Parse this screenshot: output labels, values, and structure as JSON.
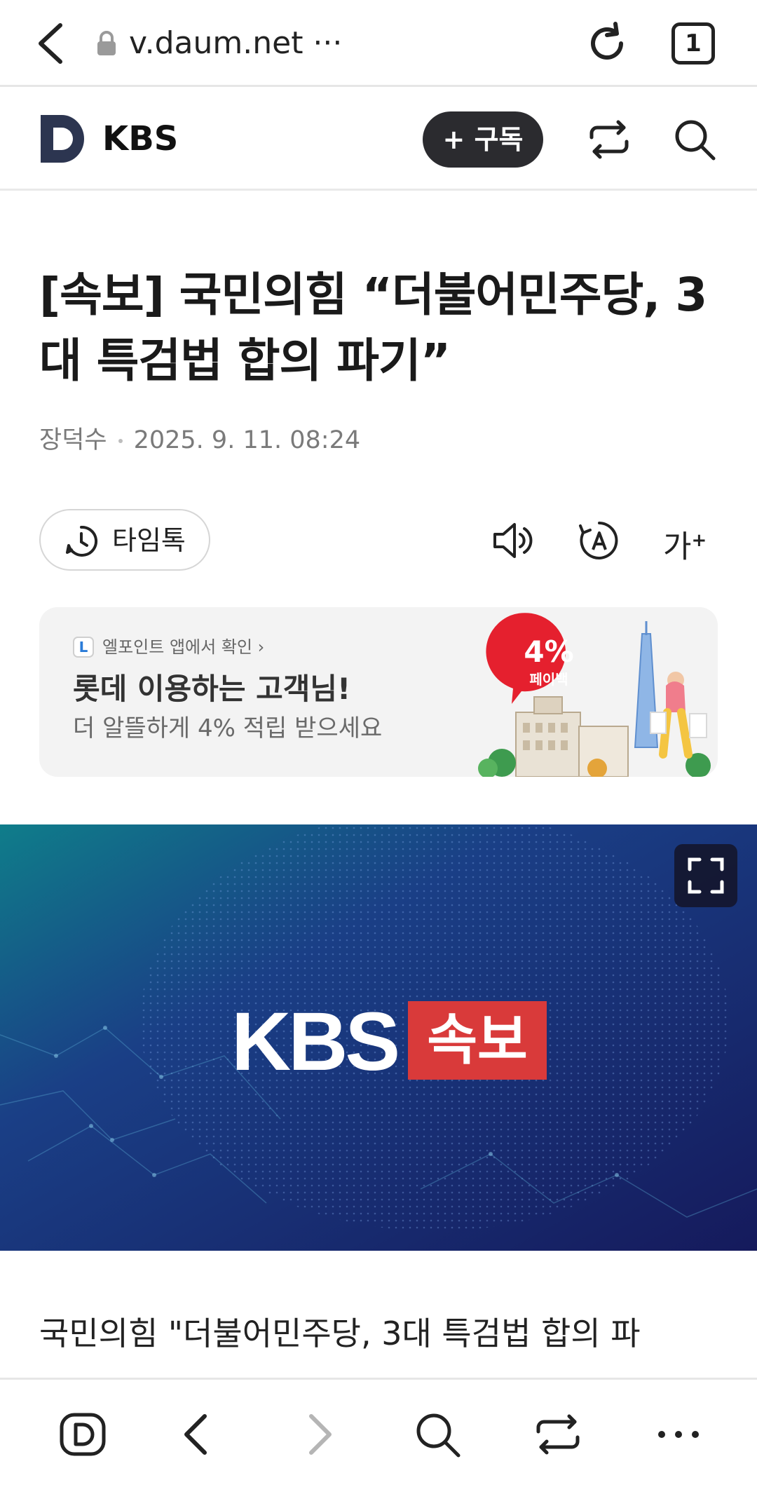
{
  "browser": {
    "url": "v.daum.net ···",
    "tab_count": "1",
    "icons": [
      "back-arrow-icon",
      "lock-icon",
      "reload-icon",
      "tab-counter"
    ]
  },
  "site_header": {
    "press_name": "KBS",
    "subscribe_label": "+ 구독",
    "icons": [
      "daum-logo-icon",
      "share-icon",
      "search-icon"
    ]
  },
  "article": {
    "headline": "[속보] 국민의힘 “더불어민주당, 3대 특검법 합의 파기”",
    "author": "장덕수",
    "datetime": "2025. 9. 11. 08:24",
    "timetalk_label": "타임톡",
    "font_size_label": "가",
    "lead_text": "국민의힘 \"더불어민주당, 3대 특검법 합의 파"
  },
  "ad": {
    "brand_badge": "L",
    "small_text": "엘포인트 앱에서 확인 ›",
    "main_text": "롯데 이용하는 고객님!",
    "sub_text": "더 알뜰하게 4% 적립 받으세요",
    "bubble_percent": "4%",
    "bubble_text": "페이백"
  },
  "hero": {
    "logo_text": "KBS",
    "tag_text": "속보"
  },
  "colors": {
    "subscribe_bg": "#2b2b2f",
    "breaking_red": "#d93a3a",
    "hero_dark": "#151a5c",
    "hero_teal": "#0f7d8a",
    "daum_navy": "#2c3550"
  },
  "bottom_nav": {
    "icons": [
      "daum-home-icon",
      "back-icon",
      "forward-icon",
      "search-icon",
      "share-icon",
      "more-icon"
    ]
  }
}
